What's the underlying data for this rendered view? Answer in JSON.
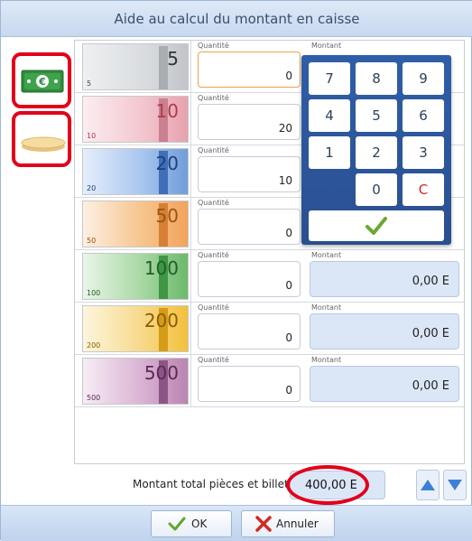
{
  "window": {
    "title": "Aide au calcul du montant en caisse"
  },
  "side": {
    "notes_icon": "banknote-euro-icon",
    "coins_icon": "coin-stack-icon"
  },
  "labels": {
    "quantity": "Quantité",
    "amount": "Montant"
  },
  "rows": [
    {
      "denomination": "5",
      "den_small": "5",
      "quantity": "0",
      "amount": "",
      "color": "#b5b9bd"
    },
    {
      "denomination": "10",
      "den_small": "10",
      "quantity": "20",
      "amount": "",
      "color": "#e8a3ad"
    },
    {
      "denomination": "20",
      "den_small": "20",
      "quantity": "10",
      "amount": "",
      "color": "#6f9bd8"
    },
    {
      "denomination": "50",
      "den_small": "50",
      "quantity": "0",
      "amount": "",
      "color": "#f2a25a"
    },
    {
      "denomination": "100",
      "den_small": "100",
      "quantity": "0",
      "amount": "0,00 E",
      "color": "#69b86a"
    },
    {
      "denomination": "200",
      "den_small": "200",
      "quantity": "0",
      "amount": "0,00 E",
      "color": "#f2c03a"
    },
    {
      "denomination": "500",
      "den_small": "500",
      "quantity": "0",
      "amount": "0,00 E",
      "color": "#b983b0"
    }
  ],
  "keypad": {
    "keys": [
      "7",
      "8",
      "9",
      "4",
      "5",
      "6",
      "1",
      "2",
      "3",
      "",
      "0",
      "C"
    ],
    "ok_icon": "checkmark-icon"
  },
  "footer": {
    "total_label": "Montant total pièces et billets",
    "total_value": "400,00 E"
  },
  "buttons": {
    "ok": "OK",
    "cancel": "Annuler"
  },
  "colors": {
    "accent": "#2f5ea8",
    "highlight": "#e2001a",
    "field": "#dbe6f7"
  }
}
